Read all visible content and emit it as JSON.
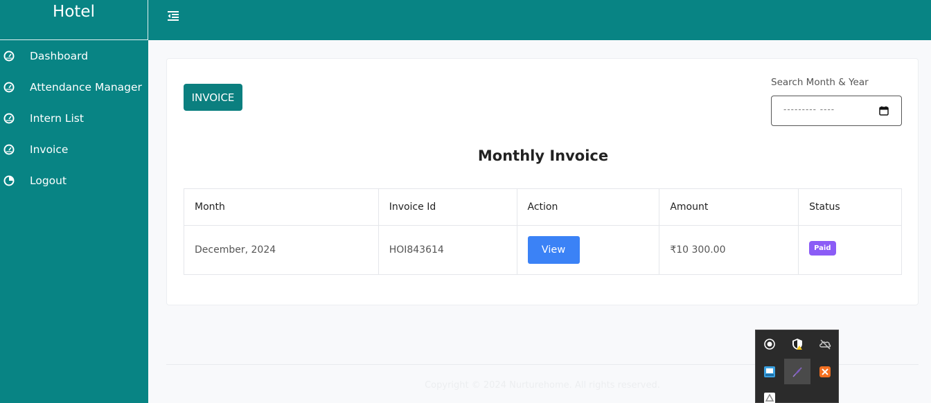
{
  "sidebar": {
    "brand": "Hotel",
    "items": [
      {
        "label": "Dashboard",
        "icon": "gauge-icon"
      },
      {
        "label": "Attendance Manager",
        "icon": "gauge-icon"
      },
      {
        "label": "Intern List",
        "icon": "gauge-icon"
      },
      {
        "label": "Invoice",
        "icon": "gauge-icon"
      },
      {
        "label": "Logout",
        "icon": "pie-chart-icon"
      }
    ]
  },
  "topbar": {
    "toggle_icon": "menu-collapse-icon"
  },
  "main": {
    "badge": "INVOICE",
    "search": {
      "label": "Search Month & Year",
      "placeholder": "--------- ----"
    },
    "title": "Monthly Invoice",
    "table": {
      "headers": [
        "Month",
        "Invoice Id",
        "Action",
        "Amount",
        "Status"
      ],
      "rows": [
        {
          "month": "December, 2024",
          "invoice_id": "HOI843614",
          "action": "View",
          "amount": "₹10 300.00",
          "status": "Paid"
        }
      ]
    }
  },
  "footer": {
    "copyright": "Copyright © 2024 Nurturehome. All rights reserved."
  },
  "colors": {
    "brand": "#088484",
    "button": "#3b82f6",
    "paid": "#8b5cf6"
  }
}
